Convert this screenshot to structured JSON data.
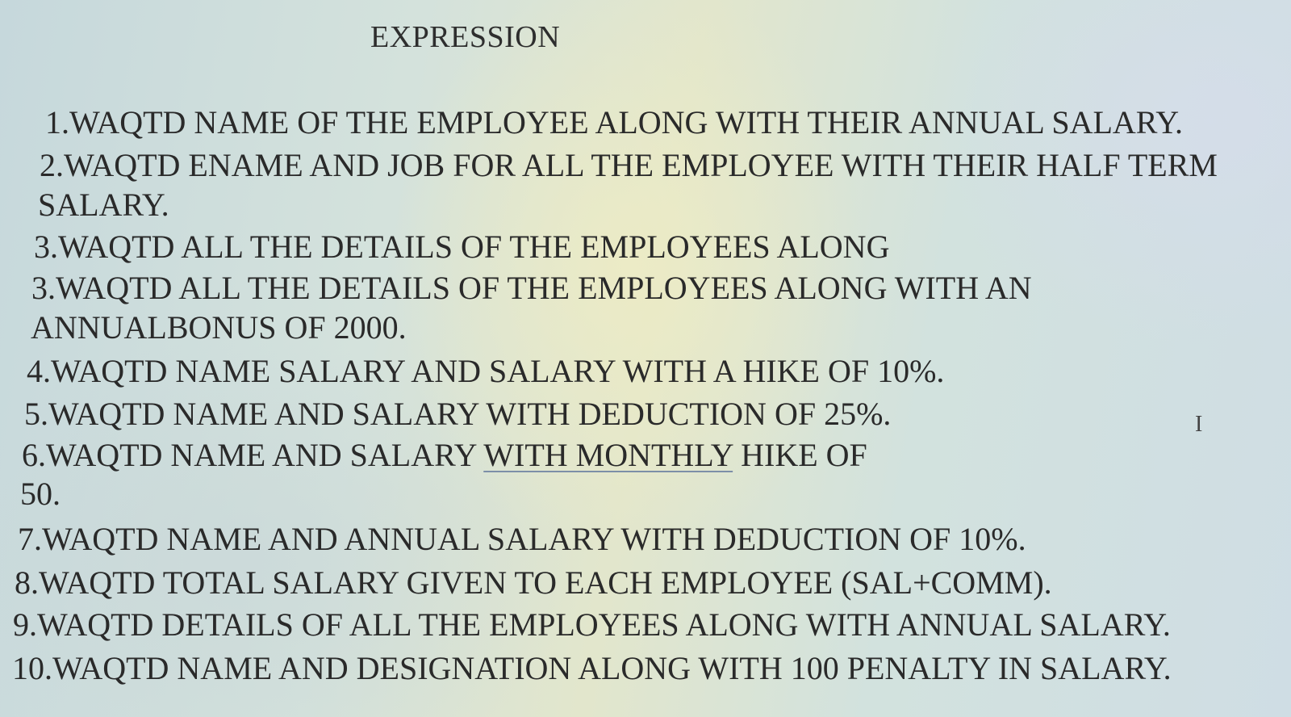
{
  "title": "EXPRESSION",
  "lines": [
    "1.WAQTD NAME OF THE EMPLOYEE ALONG WITH THEIR ANNUAL SALARY.",
    "2.WAQTD ENAME AND JOB FOR ALL THE EMPLOYEE WITH THEIR HALF TERM",
    "SALARY.",
    "3.WAQTD ALL THE DETAILS OF THE EMPLOYEES ALONG",
    "3.WAQTD ALL THE DETAILS OF THE EMPLOYEES ALONG WITH AN",
    "ANNUALBONUS OF 2000.",
    "4.WAQTD NAME SALARY AND SALARY WITH A HIKE OF 10%.",
    "5.WAQTD NAME AND SALARY WITH DEDUCTION OF 25%.",
    {
      "before": "6.WAQTD NAME AND SALARY ",
      "underlined": "WITH  MONTHLY",
      "after": " HIKE OF"
    },
    "50.",
    "7.WAQTD NAME AND ANNUAL SALARY WITH DEDUCTION OF 10%.",
    "8.WAQTD TOTAL SALARY GIVEN TO EACH EMPLOYEE (SAL+COMM).",
    "9.WAQTD DETAILS OF ALL THE EMPLOYEES ALONG WITH ANNUAL SALARY.",
    "10.WAQTD NAME AND DESIGNATION ALONG WITH 100 PENALTY IN SALARY."
  ],
  "cursor_glyph": "I"
}
